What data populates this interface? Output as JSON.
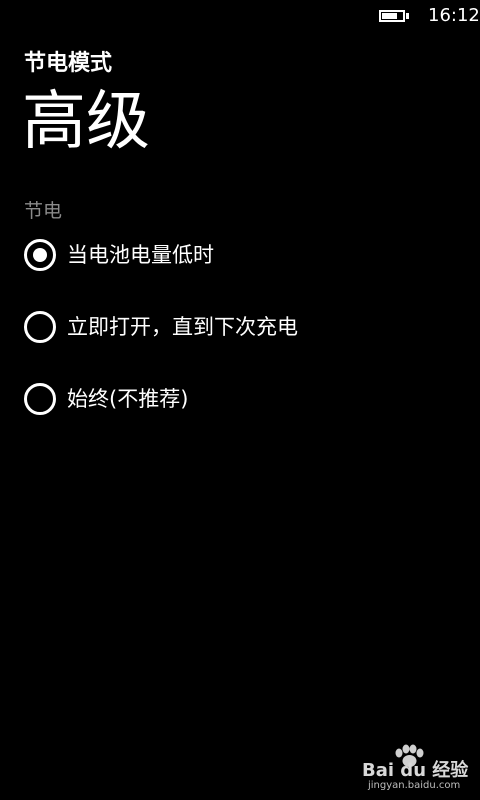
{
  "status_bar": {
    "time": "16:12",
    "battery_level": 0.75
  },
  "header": {
    "app_title": "节电模式",
    "page_title": "高级"
  },
  "section": {
    "label": "节电"
  },
  "options": [
    {
      "label": "当电池电量低时",
      "selected": true
    },
    {
      "label": "立即打开，直到下次充电",
      "selected": false
    },
    {
      "label": "始终(不推荐)",
      "selected": false
    }
  ],
  "watermark": {
    "brand": "Bai du 经验",
    "url": "jingyan.baidu.com"
  },
  "colors": {
    "background": "#000000",
    "foreground": "#ffffff",
    "muted": "#8a8a8a"
  }
}
